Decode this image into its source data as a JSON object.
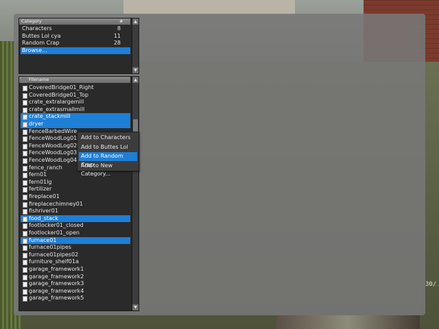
{
  "hud": {
    "counter": "30/"
  },
  "category_panel": {
    "header_category": "Category",
    "header_count": "#",
    "items": [
      {
        "name": "Characters",
        "count": "8"
      },
      {
        "name": "Buttes Lol cya",
        "count": "11"
      },
      {
        "name": "Random Crap",
        "count": "28"
      },
      {
        "name": "Browse...",
        "count": ""
      }
    ],
    "selected_index": 3
  },
  "file_panel": {
    "header_filename": "Filename",
    "items": [
      "CoveredBridge01_Right",
      "CoveredBridge01_Top",
      "crate_extralargemill",
      "crate_extrasmallmill",
      "crate_stackmill",
      "dryer",
      "FenceBarbedWire",
      "FenceWoodLog01",
      "FenceWoodLog02",
      "FenceWoodLog03",
      "FenceWoodLog04_Long",
      "fence_ranch",
      "fern01",
      "fern01lg",
      "fertilizer",
      "fireplace01",
      "fireplacechimney01",
      "fishriver01",
      "food_stack",
      "footlocker01_closed",
      "footlocker01_open",
      "furnace01",
      "furnace01pipes",
      "furnace01pipes02",
      "furniture_shelf01a",
      "garage_framework1",
      "garage_framework2",
      "garage_framework3",
      "garage_framework4",
      "garage_framework5"
    ],
    "selected": [
      "crate_stackmill",
      "dryer",
      "food_stack",
      "furnace01"
    ]
  },
  "context_menu": {
    "items": [
      "Add to Characters",
      "Add to Buttes Lol cya",
      "Add to Random Crap",
      "Add to New Category..."
    ],
    "active_index": 2
  },
  "colors": {
    "selection": "#1e7fd6",
    "panel_bg": "#2a2a2a",
    "overlay_bg": "#787878"
  }
}
